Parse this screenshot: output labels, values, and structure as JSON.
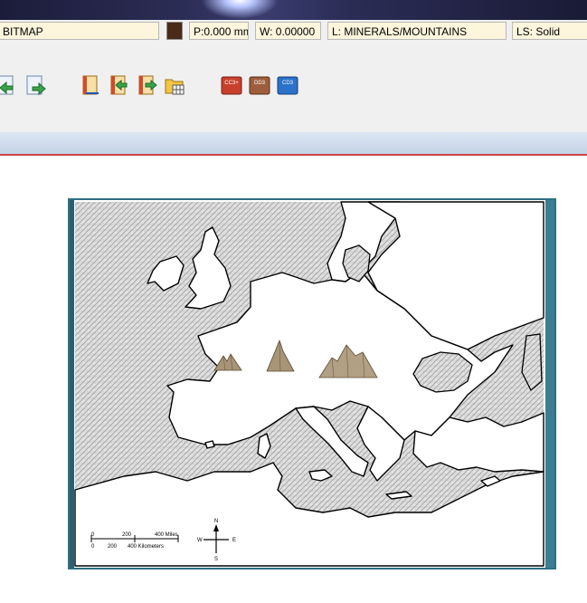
{
  "status": {
    "mode": "BITMAP",
    "color": "#4a2a18",
    "pen": "P:0.000 mm",
    "width": "W: 0.00000",
    "layer": "L: MINERALS/MOUNTAINS",
    "line_style": "LS: Solid"
  },
  "toolbar": {
    "buttons": [
      {
        "name": "arrow-left-icon"
      },
      {
        "name": "arrow-right-icon"
      },
      {
        "name": "book-icon"
      },
      {
        "name": "import-icon"
      },
      {
        "name": "export-icon"
      },
      {
        "name": "folder-grid-icon"
      },
      {
        "name": "cc3-red-icon",
        "label": "CC3+"
      },
      {
        "name": "dd3-brown-icon",
        "label": "DD3"
      },
      {
        "name": "cd3-blue-icon",
        "label": "CD3"
      }
    ]
  },
  "map": {
    "scale_miles": [
      "0",
      "200",
      "400 Miles"
    ],
    "scale_km": [
      "0",
      "200",
      "400 Kilometers"
    ],
    "compass": {
      "n": "N",
      "s": "S",
      "e": "E",
      "w": "W"
    }
  }
}
